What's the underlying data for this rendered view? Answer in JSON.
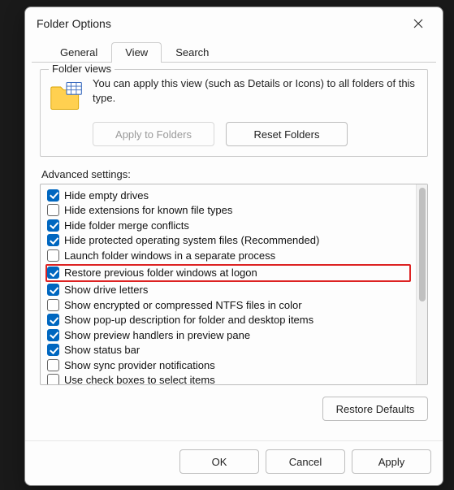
{
  "dialog": {
    "title": "Folder Options"
  },
  "tabs": {
    "general": "General",
    "view": "View",
    "search": "Search",
    "active": "view"
  },
  "folder_views": {
    "legend": "Folder views",
    "text": "You can apply this view (such as Details or Icons) to all folders of this type.",
    "apply_btn": "Apply to Folders",
    "apply_enabled": false,
    "reset_btn": "Reset Folders"
  },
  "advanced": {
    "label": "Advanced settings:",
    "items": [
      {
        "checked": true,
        "label": "Hide empty drives"
      },
      {
        "checked": false,
        "label": "Hide extensions for known file types"
      },
      {
        "checked": true,
        "label": "Hide folder merge conflicts"
      },
      {
        "checked": true,
        "label": "Hide protected operating system files (Recommended)"
      },
      {
        "checked": false,
        "label": "Launch folder windows in a separate process"
      },
      {
        "checked": true,
        "label": "Restore previous folder windows at logon",
        "highlight": true
      },
      {
        "checked": true,
        "label": "Show drive letters"
      },
      {
        "checked": false,
        "label": "Show encrypted or compressed NTFS files in color"
      },
      {
        "checked": true,
        "label": "Show pop-up description for folder and desktop items"
      },
      {
        "checked": true,
        "label": "Show preview handlers in preview pane"
      },
      {
        "checked": true,
        "label": "Show status bar"
      },
      {
        "checked": false,
        "label": "Show sync provider notifications"
      },
      {
        "checked": false,
        "label": "Use check boxes to select items"
      }
    ],
    "restore_defaults": "Restore Defaults"
  },
  "footer": {
    "ok": "OK",
    "cancel": "Cancel",
    "apply": "Apply"
  }
}
